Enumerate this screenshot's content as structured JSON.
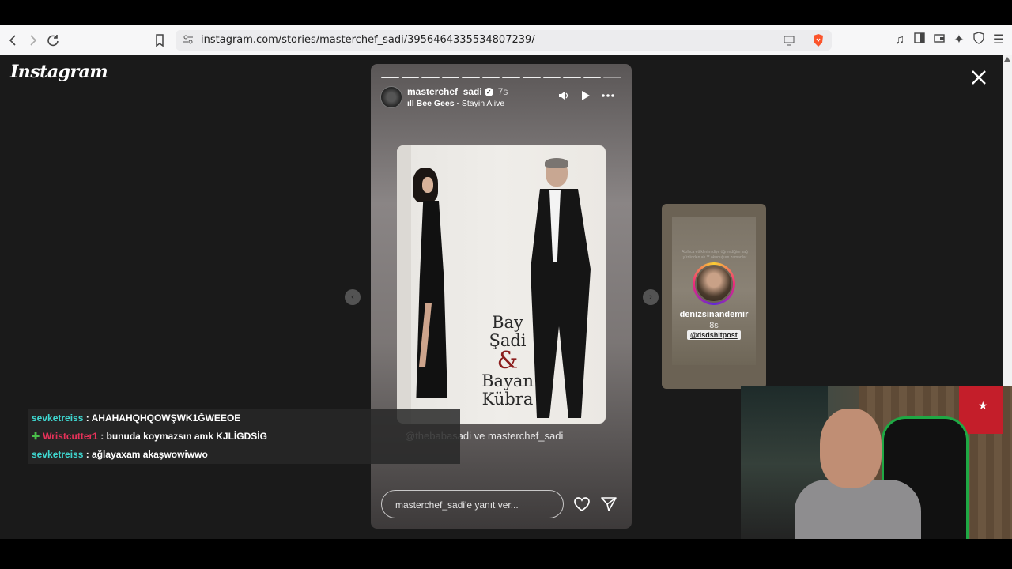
{
  "browser": {
    "url": "instagram.com/stories/masterchef_sadi/3956464335534807239/"
  },
  "instagram": {
    "logo": "Instagram"
  },
  "story": {
    "username": "masterchef_sadi",
    "time": "7s",
    "music_artist": "Bee Gees",
    "music_song": "Stayin Alive",
    "poster_line1": "Bay",
    "poster_line2": "Şadi",
    "poster_amp": "&",
    "poster_line3": "Bayan",
    "poster_line4": "Kübra",
    "tag_text": "@thebabasadi ve masterchef_sadi",
    "reply_placeholder": "masterchef_sadi'e yanıt ver...",
    "progress_total": 12,
    "progress_current": 11
  },
  "next_story": {
    "username": "denizsinandemir",
    "time": "8s",
    "mention": "@dsdshitpost",
    "faint_text": "Akıllıca ettiklerim diye öğrendiğim sağ yüzünden ah ** okuduğum zamanlar"
  },
  "chat": [
    {
      "user": "sevketreiss",
      "message": ": AHAHAHQHQOWŞWK1ĞWEEOE",
      "color": "cyan",
      "badge": false
    },
    {
      "user": "Wristcutter1",
      "message": ": bunuda koymazsın amk KJLİGDSİG",
      "color": "red",
      "badge": true
    },
    {
      "user": "sevketreiss",
      "message": ": ağlayaxam akaşwowiwwo",
      "color": "cyan",
      "badge": false
    }
  ]
}
